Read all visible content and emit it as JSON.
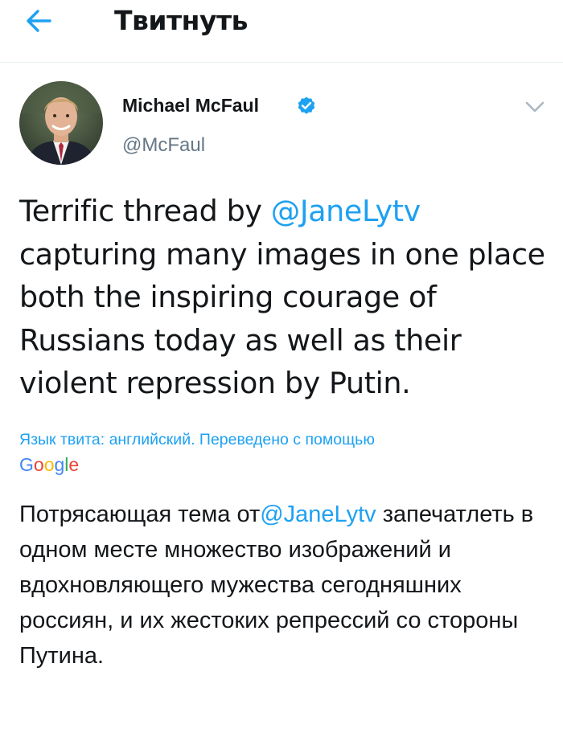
{
  "header": {
    "back_icon": "arrow-left-icon",
    "title": "Твитнуть"
  },
  "author": {
    "name": "Michael McFaul",
    "handle": "@McFaul",
    "verified_icon": "verified-badge-icon",
    "menu_icon": "chevron-down-icon"
  },
  "tweet": {
    "text_before": "Terrific thread by ",
    "mention": "@JaneLytv",
    "text_after": " capturing many images in one place both the inspiring courage of Russians today as well as their violent repression by Putin."
  },
  "translation": {
    "note": "Язык твита: английский. Переведено с помощью",
    "provider": [
      "G",
      "o",
      "o",
      "g",
      "l",
      "e"
    ],
    "text_before": "Потрясающая тема от",
    "mention": "@JaneLytv",
    "text_after": " запечатлеть в одном месте множество изображений и вдохновляющего мужества сегодняшних россиян, и их жестоких репрессий со стороны Путина."
  },
  "colors": {
    "accent": "#1da1f2",
    "text": "#14171a",
    "secondary": "#657786",
    "google": [
      "#4285f4",
      "#ea4335",
      "#fbbc05",
      "#4285f4",
      "#34a853",
      "#ea4335"
    ]
  }
}
